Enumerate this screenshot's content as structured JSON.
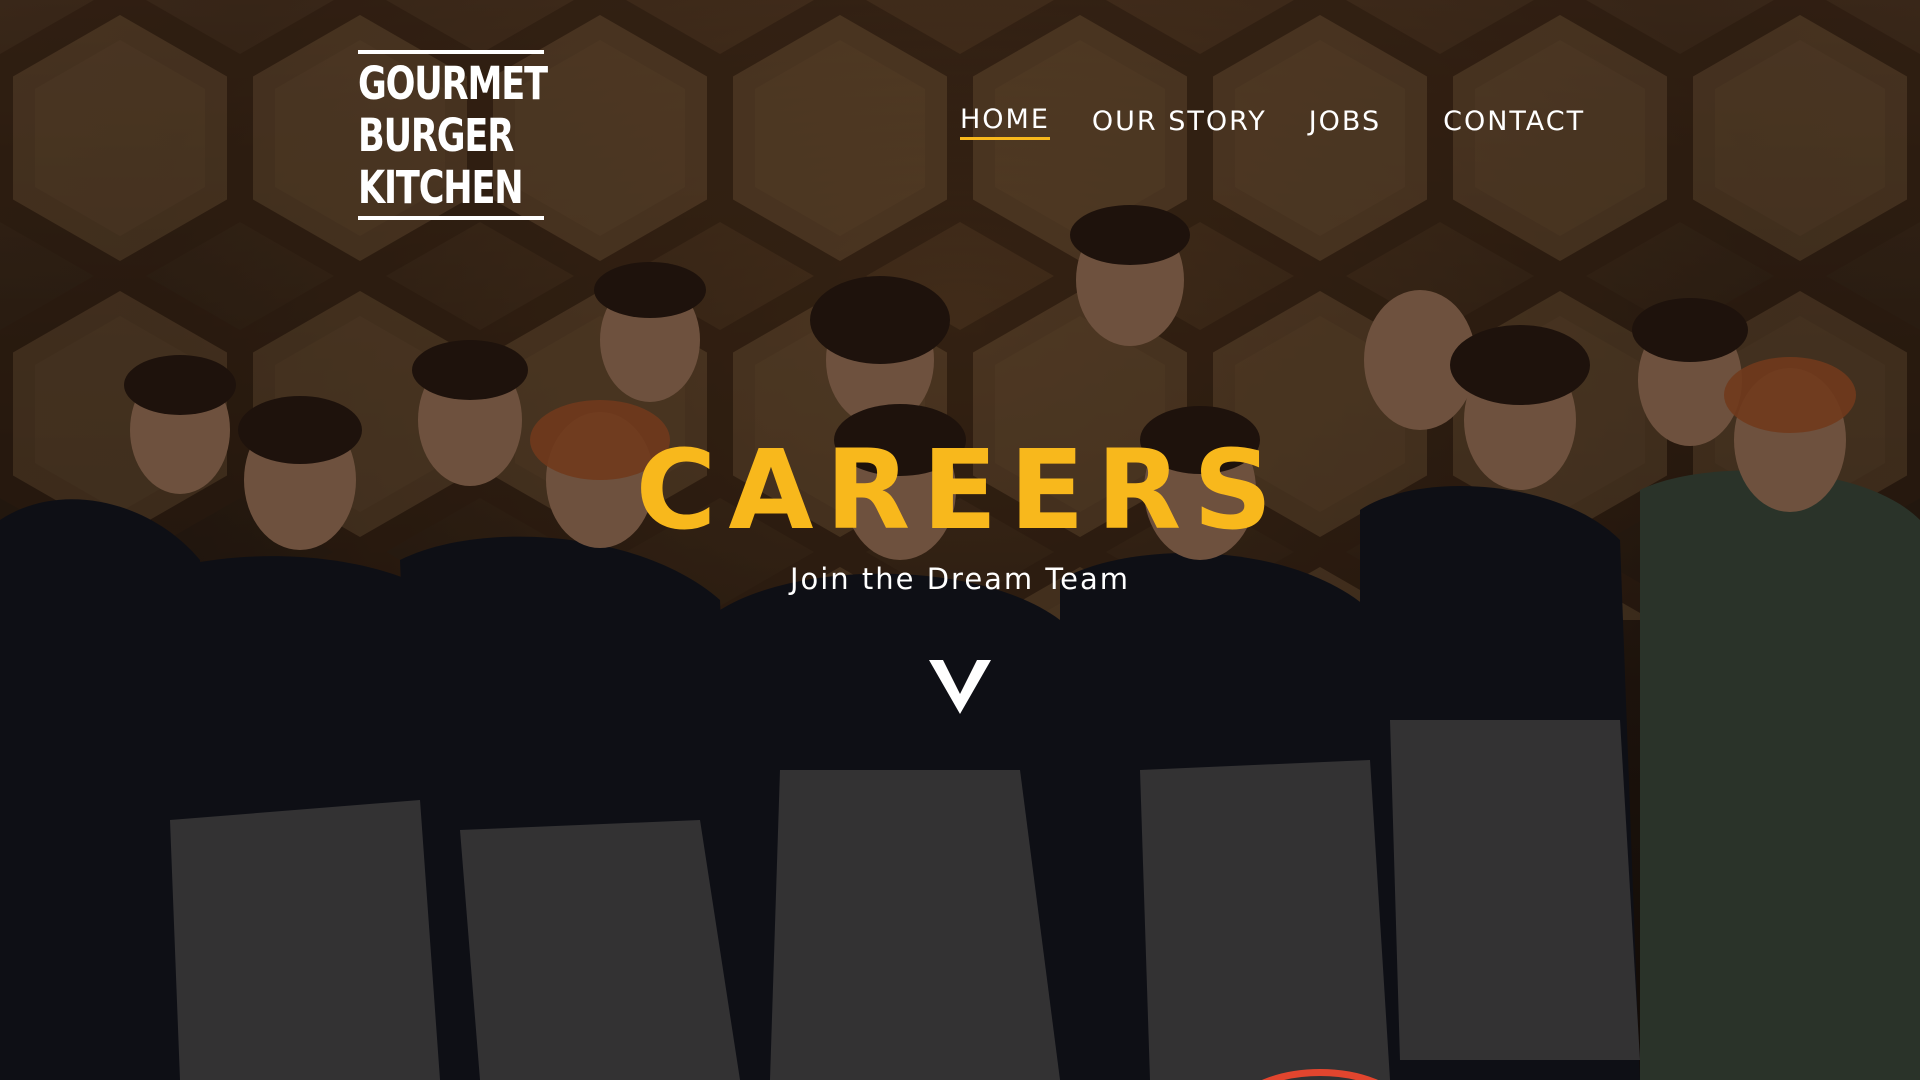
{
  "brand": {
    "logo_lines": [
      "GOURMET",
      "BURGER",
      "KITCHEN"
    ],
    "accent_color": "#f8b81c"
  },
  "nav": {
    "items": [
      {
        "label": "HOME",
        "active": true
      },
      {
        "label": "OUR STORY",
        "active": false
      },
      {
        "label": "JOBS",
        "active": false
      },
      {
        "label": "CONTACT",
        "active": false
      }
    ]
  },
  "hero": {
    "title": "CAREERS",
    "subtitle": "Join the Dream Team",
    "scroll_icon": "chevron-down-icon",
    "background": "team-photo"
  }
}
